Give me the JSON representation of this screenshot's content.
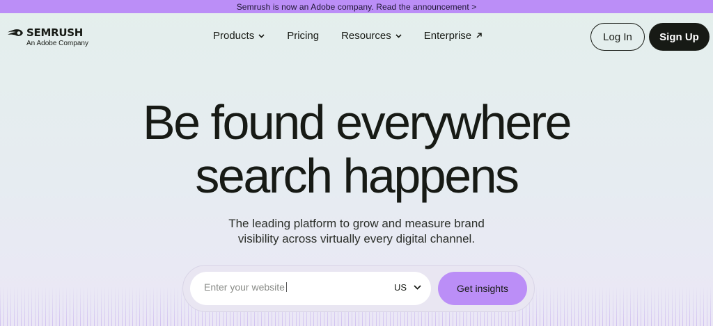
{
  "banner": {
    "text": "Semrush is now an Adobe company. Read the announcement >"
  },
  "logo": {
    "wordmark": "SEMRUSH",
    "tagline": "An Adobe Company",
    "icon": "semrush-fireball-icon"
  },
  "nav": {
    "items": [
      {
        "label": "Products",
        "icon": "chevron-down-icon"
      },
      {
        "label": "Pricing"
      },
      {
        "label": "Resources",
        "icon": "chevron-down-icon"
      },
      {
        "label": "Enterprise",
        "icon": "arrow-up-right-icon"
      }
    ]
  },
  "auth": {
    "login_label": "Log In",
    "signup_label": "Sign Up"
  },
  "hero": {
    "title_line1": "Be found everywhere",
    "title_line2": "search happens",
    "subtitle_line1": "The leading platform to grow and measure brand",
    "subtitle_line2": "visibility across virtually every digital channel."
  },
  "search": {
    "placeholder": "Enter your website",
    "region": "US",
    "region_icon": "chevron-down-icon",
    "cta_label": "Get insights"
  },
  "colors": {
    "accent": "#bb8ef7",
    "dark": "#171a15",
    "background_top": "#e4efec",
    "background_bottom": "#ebe7f6"
  }
}
